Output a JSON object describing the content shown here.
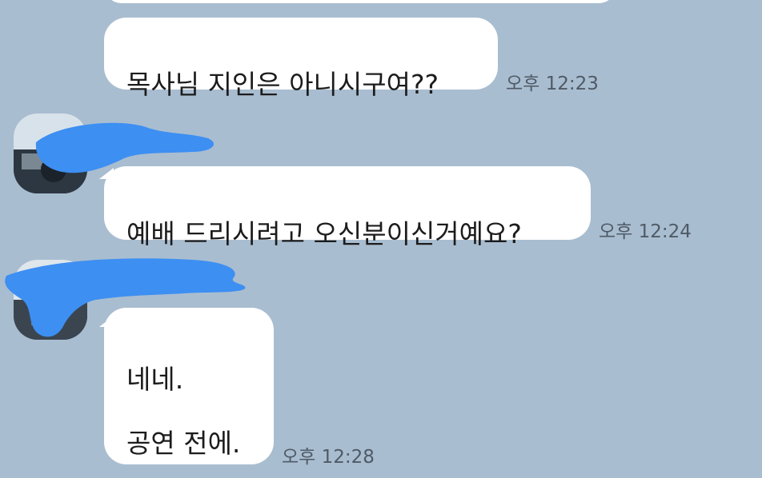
{
  "messages": [
    {
      "text": "",
      "time": ""
    },
    {
      "text": "목사님 지인은 아니시구여??",
      "time": "오후 12:23"
    },
    {
      "text": "예배 드리시려고 오신분이신거예요?",
      "time": "오후 12:24"
    },
    {
      "text": "네네.\n\n공연 전에.",
      "time": "오후 12:28"
    }
  ],
  "colors": {
    "background": "#a9bdd0",
    "bubble": "#ffffff",
    "redaction": "#3d8ff2",
    "timestamp": "#4f5a66"
  }
}
